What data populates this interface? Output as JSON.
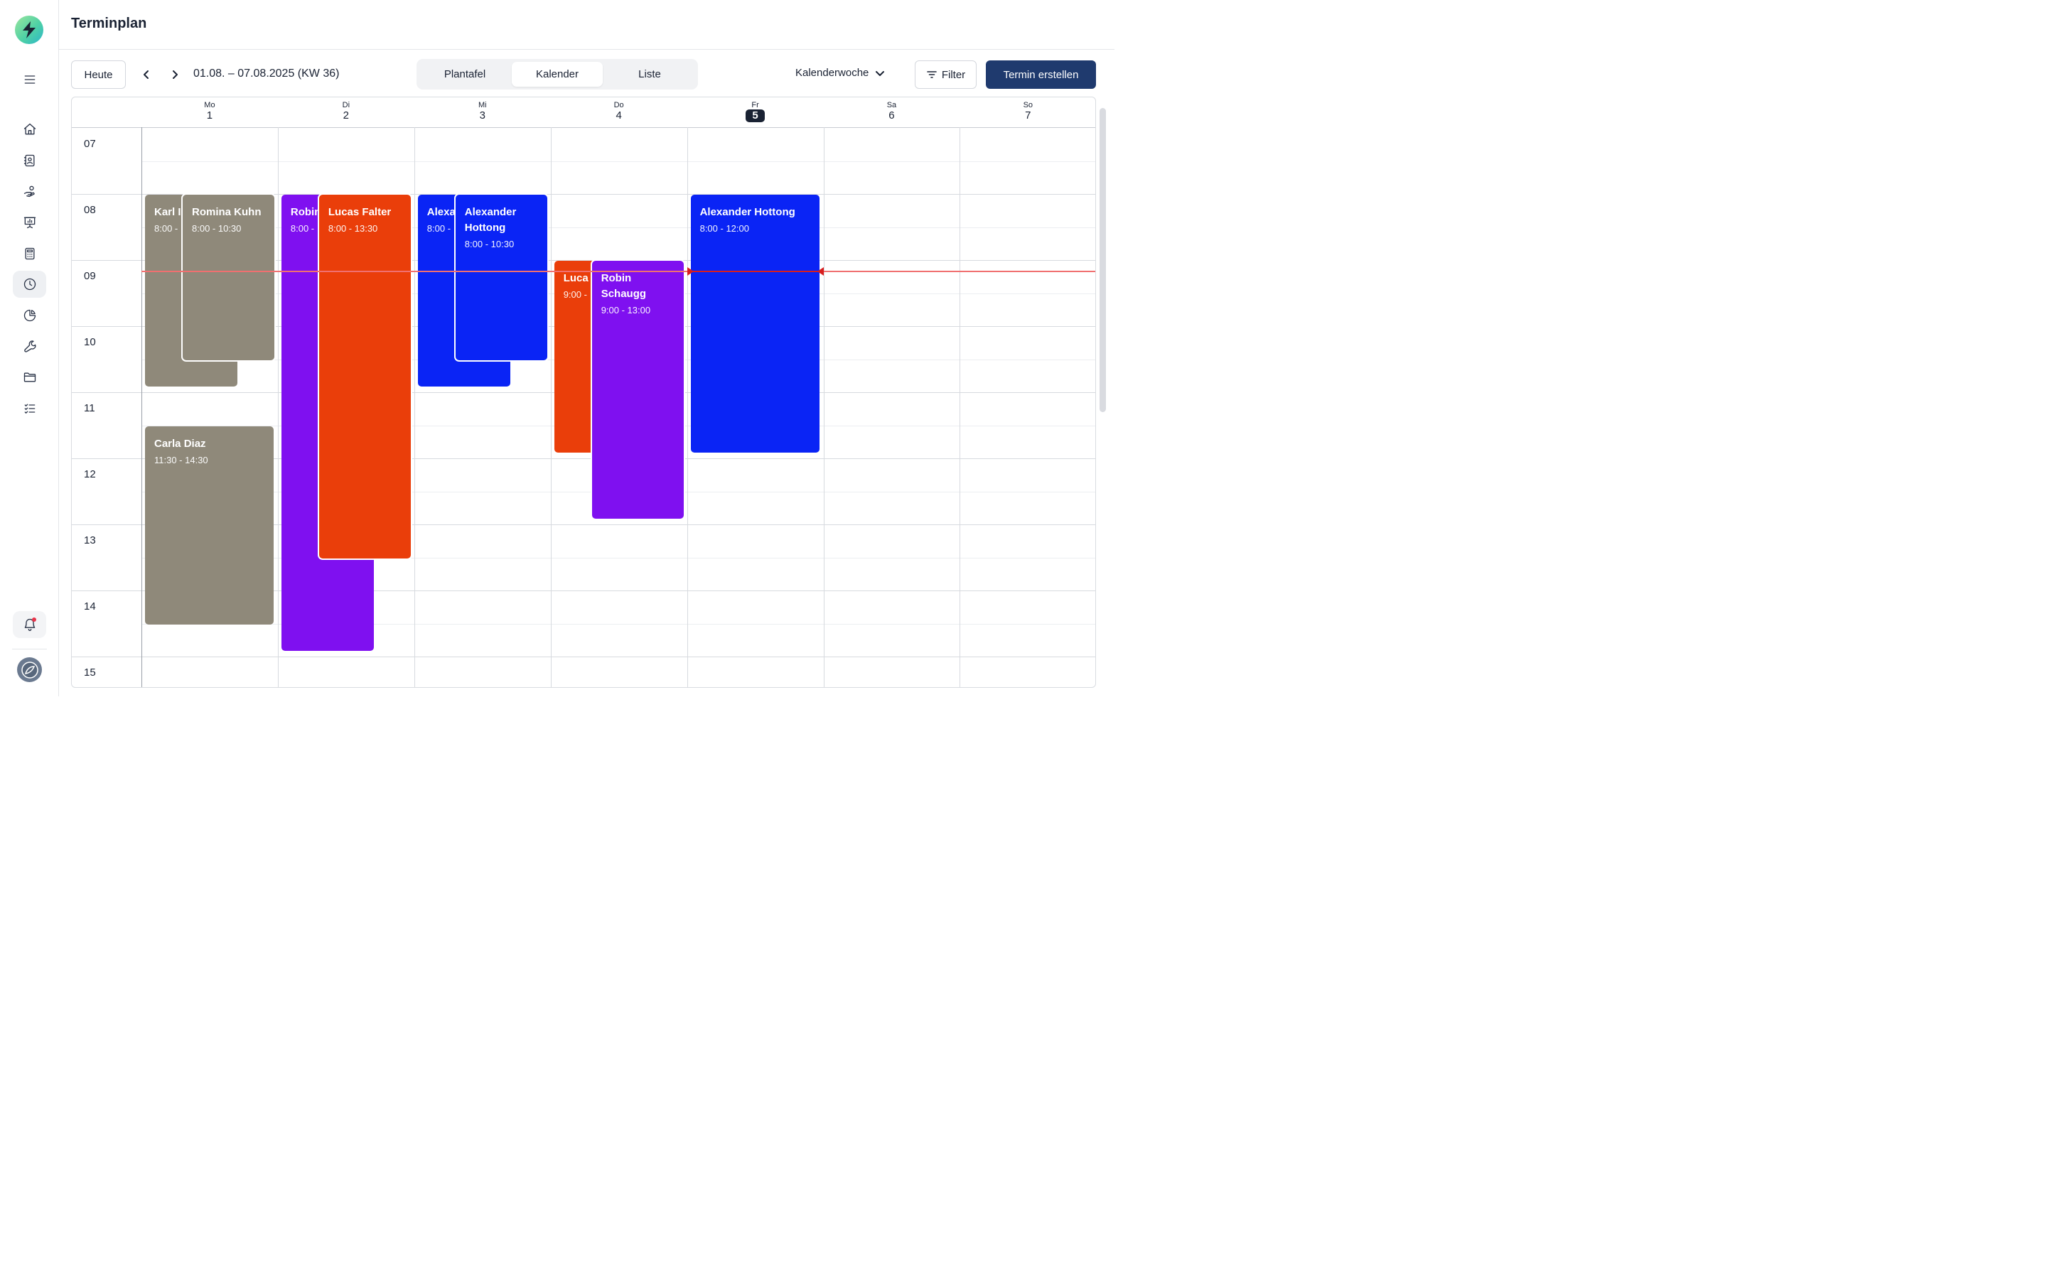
{
  "app": {
    "title": "Terminplan"
  },
  "sidebar": {
    "items": [
      {
        "icon": "menu-icon"
      },
      {
        "icon": "home-icon"
      },
      {
        "icon": "contacts-icon"
      },
      {
        "icon": "hand-coins-icon"
      },
      {
        "icon": "presentation-icon"
      },
      {
        "icon": "calculator-icon"
      },
      {
        "icon": "clock-icon",
        "active": true
      },
      {
        "icon": "pie-chart-icon"
      },
      {
        "icon": "wrench-icon"
      },
      {
        "icon": "folder-icon"
      },
      {
        "icon": "checklist-icon"
      }
    ],
    "bottom": [
      {
        "icon": "bell-icon",
        "has_notification": true
      },
      {
        "icon": "avatar-icon"
      }
    ]
  },
  "toolbar": {
    "today_label": "Heute",
    "range_label": "01.08. – 07.08.2025 (KW 36)",
    "views": [
      {
        "label": "Plantafel",
        "active": false
      },
      {
        "label": "Kalender",
        "active": true
      },
      {
        "label": "Liste",
        "active": false
      }
    ],
    "period_label": "Kalenderwoche",
    "filter_label": "Filter",
    "create_label": "Termin erstellen"
  },
  "calendar": {
    "days": [
      {
        "name": "Mo",
        "num": "1",
        "today": false
      },
      {
        "name": "Di",
        "num": "2",
        "today": false
      },
      {
        "name": "Mi",
        "num": "3",
        "today": false
      },
      {
        "name": "Do",
        "num": "4",
        "today": false
      },
      {
        "name": "Fr",
        "num": "5",
        "today": true
      },
      {
        "name": "Sa",
        "num": "6",
        "today": false
      },
      {
        "name": "So",
        "num": "7",
        "today": false
      }
    ],
    "hours": [
      "07",
      "08",
      "09",
      "10",
      "11",
      "12",
      "13",
      "14",
      "15"
    ],
    "now_time": 9.15,
    "colors": {
      "taupe": "#8f897a",
      "purple": "#7f10f0",
      "orange": "#ea3e0a",
      "blue": "#0a24f5"
    },
    "events": [
      {
        "day": 0,
        "lane": 0,
        "name": "Karl I",
        "time": "8:00 -",
        "start": 8,
        "end": 10.9,
        "color": "#8f897a"
      },
      {
        "day": 0,
        "lane": 1,
        "name": "Romina Kuhn",
        "time": "8:00 - 10:30",
        "start": 8,
        "end": 10.5,
        "color": "#8f897a",
        "outlined": true
      },
      {
        "day": 0,
        "lane": 2,
        "name": "Carla Diaz",
        "time": "11:30 - 14:30",
        "start": 11.5,
        "end": 14.5,
        "color": "#8f897a"
      },
      {
        "day": 1,
        "lane": 0,
        "name": "Robin Scha",
        "time": "8:00 -",
        "start": 8,
        "end": 14.9,
        "color": "#7f10f0"
      },
      {
        "day": 1,
        "lane": 1,
        "name": "Lucas Falter",
        "time": "8:00 - 13:30",
        "start": 8,
        "end": 13.5,
        "color": "#ea3e0a",
        "outlined": true
      },
      {
        "day": 2,
        "lane": 0,
        "name": "Alexa Hotto",
        "time": "8:00 -",
        "start": 8,
        "end": 10.9,
        "color": "#0a24f5"
      },
      {
        "day": 2,
        "lane": 1,
        "name": "Alexander Hottong",
        "time": "8:00 - 10:30",
        "start": 8,
        "end": 10.5,
        "color": "#0a24f5",
        "outlined": true
      },
      {
        "day": 3,
        "lane": 0,
        "name": "Luca",
        "time": "9:00 -",
        "start": 9,
        "end": 11.9,
        "color": "#ea3e0a"
      },
      {
        "day": 3,
        "lane": 1,
        "name": "Robin Schaugg",
        "time": "9:00 - 13:00",
        "start": 9,
        "end": 12.9,
        "color": "#7f10f0",
        "outlined": true
      },
      {
        "day": 4,
        "lane": 2,
        "name": "Alexander Hottong",
        "time": "8:00 - 12:00",
        "start": 8,
        "end": 11.9,
        "color": "#0a24f5"
      }
    ]
  }
}
